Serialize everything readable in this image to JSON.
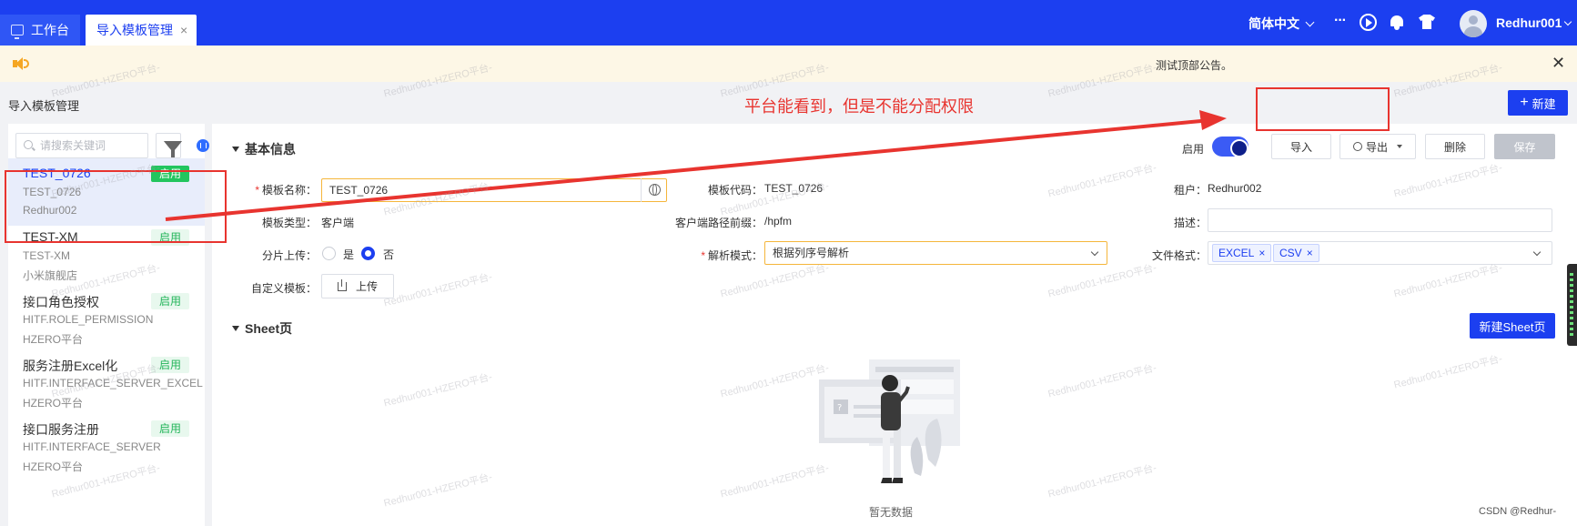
{
  "tabs": [
    {
      "label": "工作台"
    },
    {
      "label": "导入模板管理",
      "close": "×"
    }
  ],
  "topbar": {
    "language": "简体中文",
    "more": "···",
    "username": "Redhur001"
  },
  "announcement": {
    "text": "测试顶部公告。",
    "close": "✕"
  },
  "page": {
    "title": "导入模板管理",
    "new_button": "新建",
    "annotation": "平台能看到，但是不能分配权限"
  },
  "sidebar": {
    "search_placeholder": "请搜索关键词",
    "items": [
      {
        "name": "TEST_0726",
        "code": "TEST_0726",
        "tenant": "Redhur002",
        "status": "启用"
      },
      {
        "name": "TEST-XM",
        "code": "TEST-XM",
        "tenant": "小米旗舰店",
        "status": "启用"
      },
      {
        "name": "接口角色授权",
        "code": "HITF.ROLE_PERMISSION",
        "tenant": "HZERO平台",
        "status": "启用"
      },
      {
        "name": "服务注册Excel化",
        "code": "HITF.INTERFACE_SERVER_EXCEL",
        "tenant": "HZERO平台",
        "status": "启用"
      },
      {
        "name": "接口服务注册",
        "code": "HITF.INTERFACE_SERVER",
        "tenant": "HZERO平台",
        "status": "启用"
      }
    ]
  },
  "basic": {
    "section_title": "基本信息",
    "enable_label": "启用",
    "import_button": "导入",
    "export_button": "导出",
    "delete_button": "删除",
    "save_button": "保存",
    "fields": {
      "template_name_label": "模板名称：",
      "template_name_value": "TEST_0726",
      "template_code_label": "模板代码：",
      "template_code_value": "TEST_0726",
      "tenant_label": "租户：",
      "tenant_value": "Redhur002",
      "template_type_label": "模板类型：",
      "template_type_value": "客户端",
      "client_prefix_label": "客户端路径前缀：",
      "client_prefix_value": "/hpfm",
      "desc_label": "描述：",
      "desc_value": "",
      "shard_upload_label": "分片上传：",
      "shard_yes": "是",
      "shard_no": "否",
      "parse_mode_label": "解析模式：",
      "parse_mode_value": "根据列序号解析",
      "file_format_label": "文件格式：",
      "file_formats": [
        "EXCEL",
        "CSV"
      ],
      "custom_template_label": "自定义模板：",
      "upload_button": "上传"
    }
  },
  "sheet": {
    "section_title": "Sheet页",
    "new_sheet_button": "新建Sheet页",
    "empty_text": "暂无数据"
  },
  "watermark_text": "Redhur001-HZERO平台-",
  "footer_credit": "CSDN @Redhur-",
  "colors": {
    "primary": "#1c3ff0",
    "success": "#22c55e",
    "annotation_red": "#e8342f",
    "announce_bg": "#fdf7e6"
  }
}
